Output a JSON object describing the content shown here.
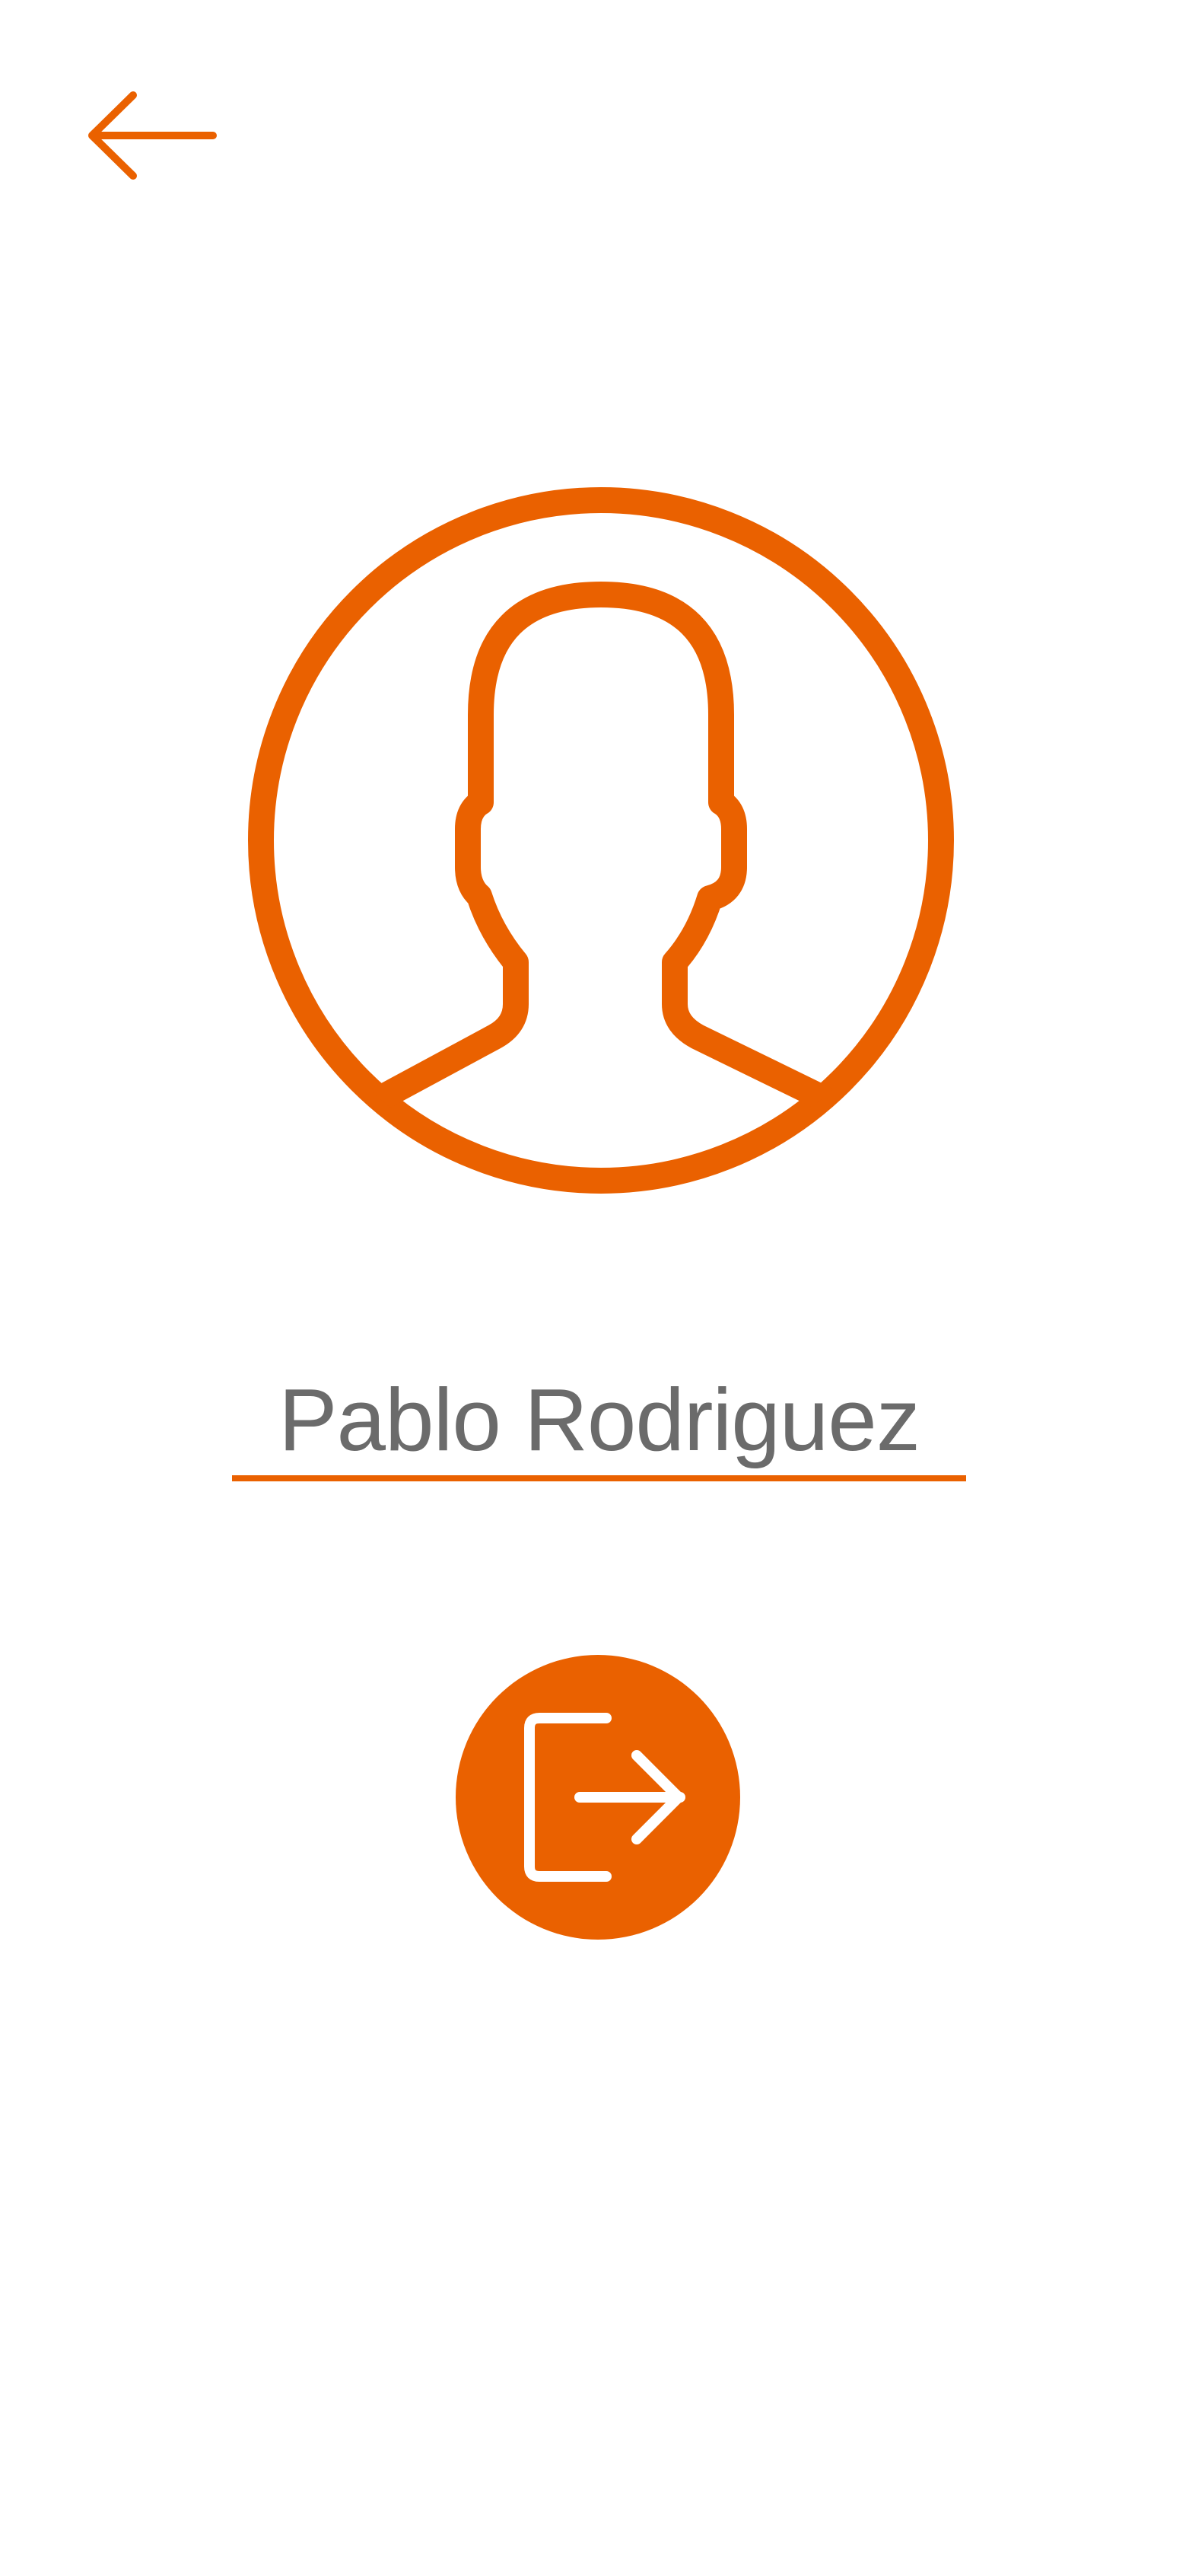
{
  "user": {
    "name": "Pablo Rodriguez"
  },
  "icons": {
    "back": "arrow-left-icon",
    "avatar": "user-silhouette-icon",
    "logout": "logout-icon"
  },
  "colors": {
    "accent": "#ea6100",
    "text": "#6b6b6b",
    "background": "#ffffff"
  }
}
